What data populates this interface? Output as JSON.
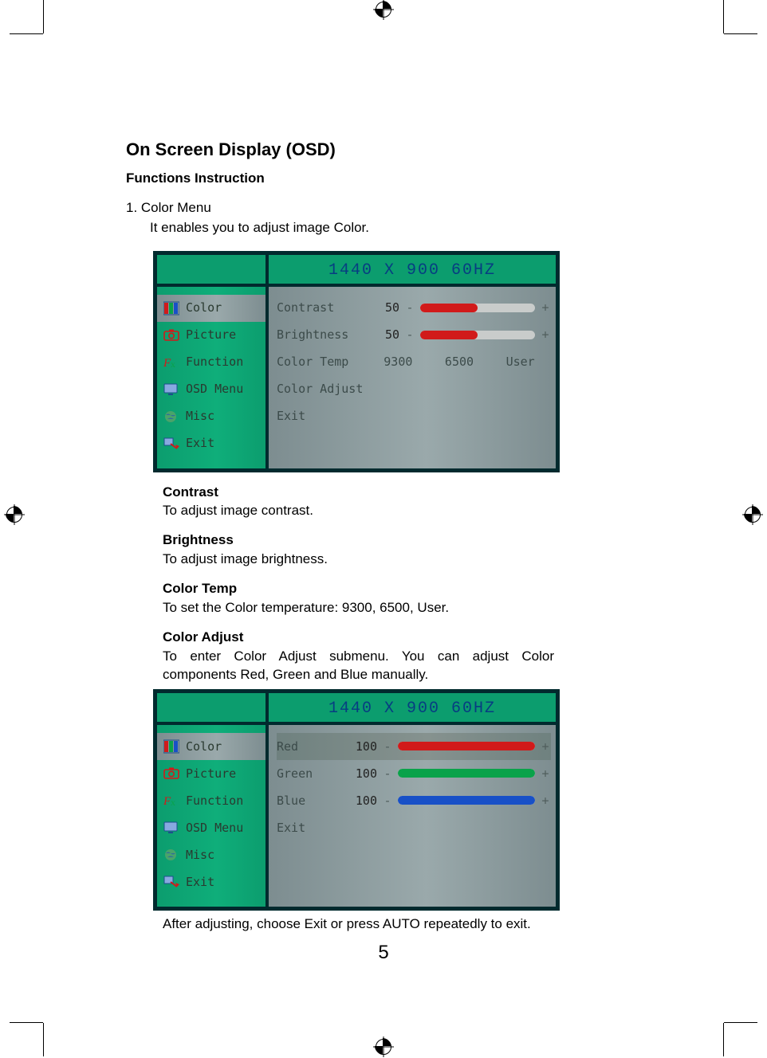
{
  "page_title": "On Screen Display (OSD)",
  "subtitle": "Functions Instruction",
  "menu_num": "1. Color Menu",
  "menu_num_desc": "It enables you to adjust image Color.",
  "sidebar": {
    "items": [
      {
        "label": "Color"
      },
      {
        "label": "Picture"
      },
      {
        "label": "Function"
      },
      {
        "label": "OSD Menu"
      },
      {
        "label": "Misc"
      },
      {
        "label": "Exit"
      }
    ]
  },
  "osd1": {
    "head": "1440 X 900     60HZ",
    "rows": {
      "contrast": {
        "label": "Contrast",
        "value": "50",
        "pct": 50,
        "color": "#d11a1a"
      },
      "brightness": {
        "label": "Brightness",
        "value": "50",
        "pct": 50,
        "color": "#d11a1a"
      },
      "colortemp": {
        "label": "Color Temp",
        "opts": [
          "9300",
          "6500",
          "User"
        ]
      },
      "coloradjust": {
        "label": "Color Adjust"
      },
      "exit": {
        "label": "Exit"
      }
    }
  },
  "osd2": {
    "head": "1440 X 900     60HZ",
    "rows": {
      "red": {
        "label": "Red",
        "value": "100",
        "pct": 100,
        "color": "#d11a1a"
      },
      "green": {
        "label": "Green",
        "value": "100",
        "pct": 100,
        "color": "#0aa24a"
      },
      "blue": {
        "label": "Blue",
        "value": "100",
        "pct": 100,
        "color": "#1850c7"
      },
      "exit": {
        "label": "Exit"
      }
    }
  },
  "desc": {
    "contrast_h": "Contrast",
    "contrast_b": "To adjust image contrast.",
    "brightness_h": "Brightness",
    "brightness_b": "To adjust image brightness.",
    "colortemp_h": "Color Temp",
    "colortemp_b": "To set the Color temperature: 9300, 6500, User.",
    "coloradjust_h": "Color Adjust",
    "coloradjust_b": "To enter Color Adjust submenu. You can adjust Color components Red, Green and Blue manually.",
    "after": "After adjusting, choose Exit or press AUTO repeatedly to exit."
  },
  "page_number": "5"
}
